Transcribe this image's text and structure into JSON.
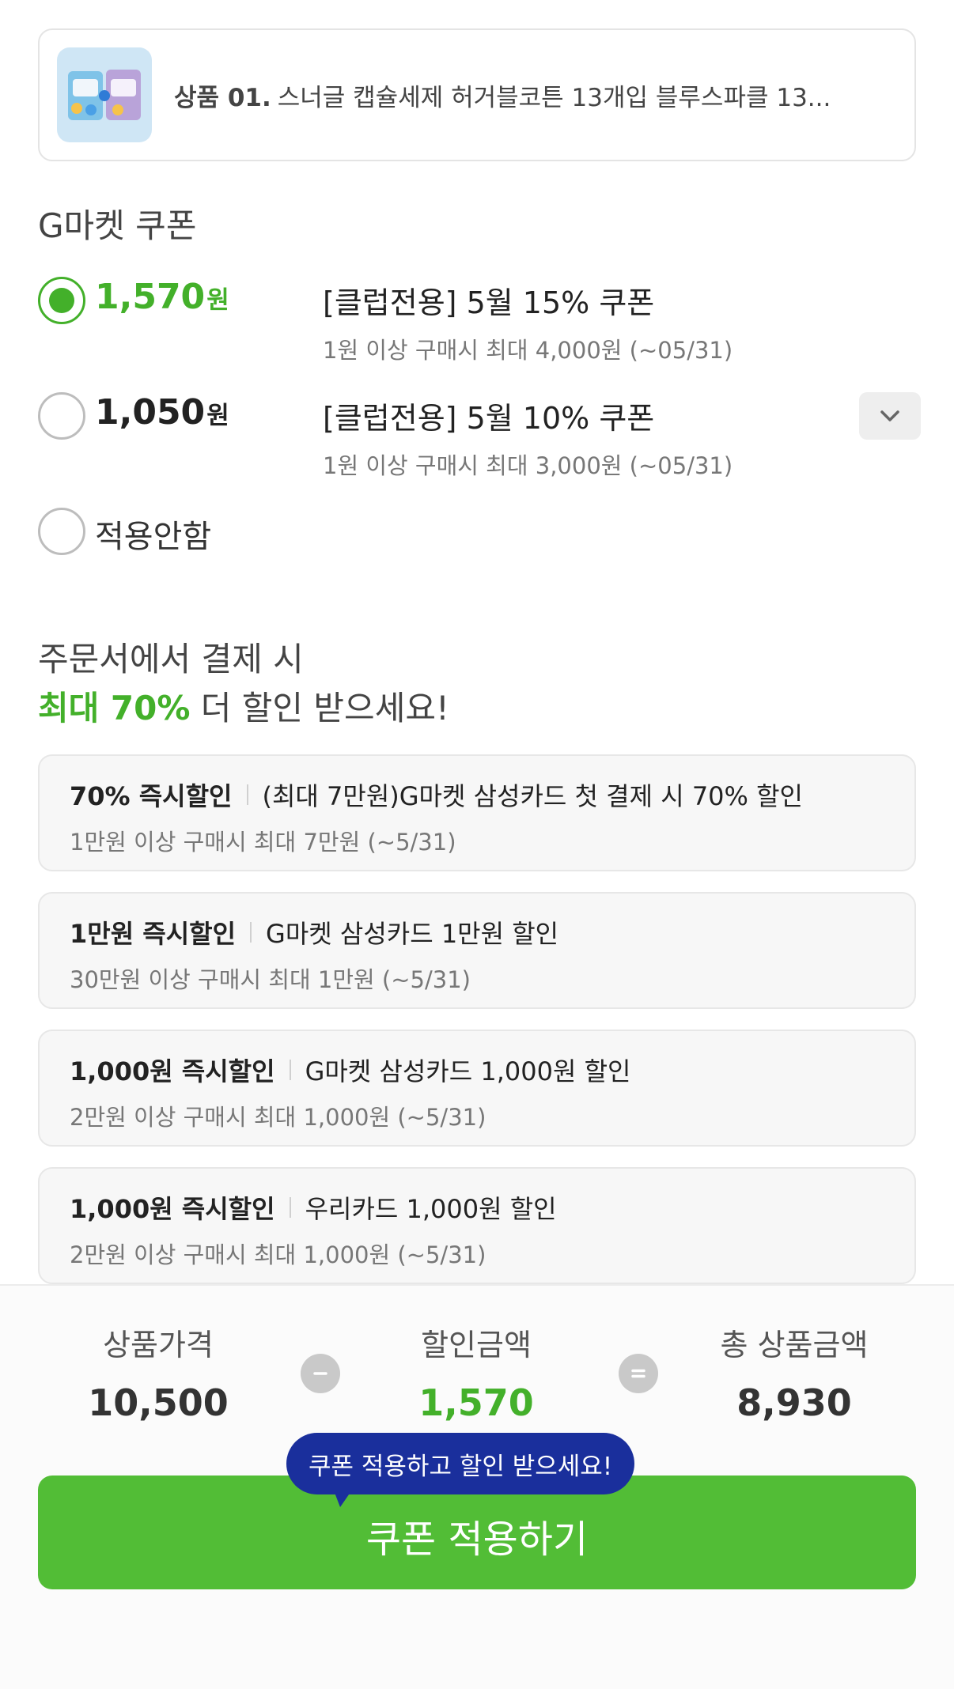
{
  "product": {
    "number": "상품 01.",
    "name": "스너글 캡슐세제 허거블코튼 13개입 블루스파클 13..."
  },
  "gmarket_coupon": {
    "title": "G마켓 쿠폰",
    "options": [
      {
        "amount": "1,570",
        "unit": "원",
        "name": "[클럽전용] 5월 15% 쿠폰",
        "condition": "1원 이상 구매시 최대 4,000원 (~05/31)",
        "selected": true
      },
      {
        "amount": "1,050",
        "unit": "원",
        "name": "[클럽전용] 5월 10% 쿠폰",
        "condition": "1원 이상 구매시 최대 3,000원 (~05/31)",
        "selected": false
      }
    ],
    "none_label": "적용안함"
  },
  "promo": {
    "heading_line1": "주문서에서 결제 시",
    "heading_highlight": "최대 70%",
    "heading_rest": " 더 할인 받으세요!",
    "cards": [
      {
        "tag": "70% 즉시할인",
        "desc": "(최대 7만원)G마켓 삼성카드 첫 결제 시 70% 할인",
        "condition": "1만원 이상 구매시 최대 7만원 (~5/31)"
      },
      {
        "tag": "1만원 즉시할인",
        "desc": "G마켓 삼성카드 1만원 할인",
        "condition": "30만원 이상 구매시 최대 1만원 (~5/31)"
      },
      {
        "tag": "1,000원 즉시할인",
        "desc": "G마켓 삼성카드 1,000원 할인",
        "condition": "2만원 이상 구매시 최대 1,000원 (~5/31)"
      },
      {
        "tag": "1,000원 즉시할인",
        "desc": "우리카드 1,000원 할인",
        "condition": "2만원 이상 구매시 최대 1,000원 (~5/31)"
      }
    ]
  },
  "summary": {
    "price_label": "상품가격",
    "price_value": "10,500",
    "discount_label": "할인금액",
    "discount_value": "1,570",
    "total_label": "총 상품금액",
    "total_value": "8,930"
  },
  "cta": {
    "tooltip": "쿠폰 적용하고 할인 받으세요!",
    "button_label": "쿠폰 적용하기"
  },
  "colors": {
    "accent_green": "#43b02a",
    "button_green": "#52bd36",
    "tooltip_navy": "#1a2f9c"
  },
  "icons": {
    "expand": "chevron-down-icon",
    "minus": "minus-icon",
    "equals": "equals-icon"
  }
}
